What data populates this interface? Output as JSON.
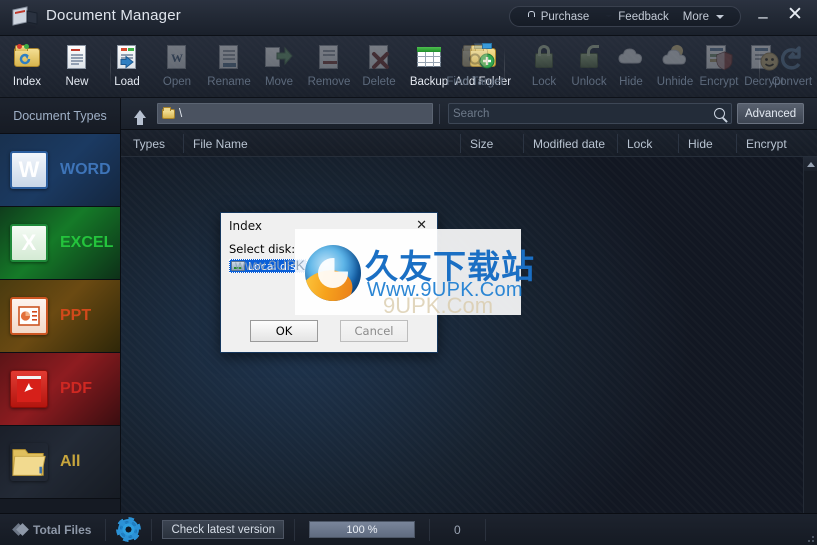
{
  "window": {
    "title": "Document Manager",
    "app_icon": "document-manager-icon",
    "minimize_label": "–",
    "close_label": "✕",
    "links": [
      {
        "label": "Purchase",
        "icon": "lock-icon"
      },
      {
        "label": "Feedback",
        "icon": "mail-icon"
      },
      {
        "label": "More",
        "icon": "chevron-down-icon"
      }
    ]
  },
  "toolbar": {
    "items": [
      {
        "label": "Index",
        "icon": "folder-refresh-icon",
        "enabled": true
      },
      {
        "label": "New",
        "icon": "new-document-icon",
        "enabled": true
      },
      {
        "label": "Load",
        "icon": "load-document-icon",
        "enabled": true
      },
      {
        "label": "Open",
        "icon": "open-word-icon",
        "enabled": false
      },
      {
        "label": "Rename",
        "icon": "rename-document-icon",
        "enabled": false
      },
      {
        "label": "Move",
        "icon": "move-document-icon",
        "enabled": false
      },
      {
        "label": "Remove",
        "icon": "remove-document-icon",
        "enabled": false
      },
      {
        "label": "Delete",
        "icon": "delete-document-icon",
        "enabled": false
      },
      {
        "label": "Backup",
        "icon": "backup-table-icon",
        "enabled": true
      },
      {
        "label": "Add Folder",
        "icon": "add-folder-icon",
        "enabled": true
      },
      {
        "label": "Find Target",
        "icon": "find-target-icon",
        "enabled": false
      },
      {
        "label": "Lock",
        "icon": "lock-icon",
        "enabled": false
      },
      {
        "label": "Unlock",
        "icon": "unlock-icon",
        "enabled": false
      },
      {
        "label": "Hide",
        "icon": "cloud-hide-icon",
        "enabled": false
      },
      {
        "label": "Unhide",
        "icon": "cloud-sun-unhide-icon",
        "enabled": false
      },
      {
        "label": "Encrypt",
        "icon": "encrypt-shield-icon",
        "enabled": false
      },
      {
        "label": "Decrypt",
        "icon": "decrypt-smiley-icon",
        "enabled": false
      },
      {
        "label": "Convert",
        "icon": "convert-arrow-icon",
        "enabled": false
      }
    ]
  },
  "sidebar": {
    "header": "Document Types",
    "items": [
      {
        "label": "WORD",
        "icon": "word-icon",
        "glyph": "W"
      },
      {
        "label": "EXCEL",
        "icon": "excel-icon",
        "glyph": "X"
      },
      {
        "label": "PPT",
        "icon": "ppt-icon",
        "glyph": ""
      },
      {
        "label": "PDF",
        "icon": "pdf-icon",
        "glyph": ""
      },
      {
        "label": "All",
        "icon": "folder-all-icon",
        "glyph": ""
      }
    ]
  },
  "pathbar": {
    "up_icon": "arrow-up-icon",
    "folder_icon": "folder-icon",
    "path_value": "\\",
    "search_placeholder": "Search",
    "search_value": "",
    "search_icon": "magnifier-icon",
    "advanced_label": "Advanced"
  },
  "columns": [
    {
      "label": "Types"
    },
    {
      "label": "File Name"
    },
    {
      "label": "Size"
    },
    {
      "label": "Modified date"
    },
    {
      "label": "Lock"
    },
    {
      "label": "Hide"
    },
    {
      "label": "Encrypt"
    }
  ],
  "dialog": {
    "title": "Index",
    "close_label": "✕",
    "field_label": "Select disk:",
    "disk_icon": "disk-drive-icon",
    "disk_selected": "Local disk",
    "ok_label": "OK",
    "cancel_label": "Cancel"
  },
  "watermark": {
    "site_name_cn": "久友下载站",
    "site_url": "Www.9UPK.Com",
    "ghost_text": "www.9UPK.com",
    "ghost_text2": "9UPK.Com",
    "logo_icon": "globe-logo-icon"
  },
  "statusbar": {
    "total_files_label": "Total Files",
    "total_files_icon": "diamonds-icon",
    "settings_icon": "gear-icon",
    "check_version_label": "Check latest version",
    "progress_text": "100 %",
    "progress_value": 100,
    "count": "0",
    "resize_grip_icon": "resize-grip-icon"
  },
  "colors": {
    "accent_blue": "#2b92d6",
    "word": "#3e74b8",
    "excel": "#24c43c",
    "ppt": "#d2491b",
    "pdf": "#cf2822",
    "all": "#c8a63d",
    "dialog_select": "#0a5fd8",
    "watermark_blue": "#1a6fc4"
  }
}
